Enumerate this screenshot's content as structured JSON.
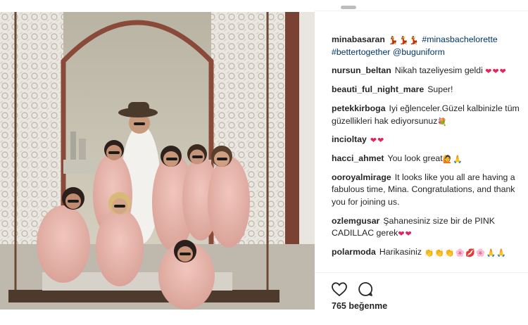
{
  "post": {
    "likes": "765 beğenme",
    "caption": {
      "user": "minabasaran",
      "emojis": "💃💃💃",
      "hashtags": [
        "#minasbachelorette",
        "#bettertogether"
      ],
      "mention": "@buguniform"
    }
  },
  "comments": [
    {
      "user": "nursun_beltan",
      "text": "Nikah tazeliyesim geldi",
      "emoji": "❤❤❤"
    },
    {
      "user": "beauti_ful_night_mare",
      "text": "Super!",
      "emoji": ""
    },
    {
      "user": "petekkirboga",
      "text": "Iyi eğlenceler.Güzel kalbinizle tüm güzellikleri hak ediyorsunuz",
      "emoji": "💐"
    },
    {
      "user": "incioltay",
      "text": "",
      "emoji": "❤❤"
    },
    {
      "user": "hacci_ahmet",
      "text": "You look great",
      "emoji": "🙋🙏"
    },
    {
      "user": "ooroyalmirage",
      "text": "It looks like you all are having a fabulous time, Mina. Congratulations, and thank you for joining us.",
      "emoji": ""
    },
    {
      "user": "ozlemgusar",
      "text": "Şahanesiniz size bir de PINK CADILLAC gerek",
      "emoji": "❤❤"
    },
    {
      "user": "polarmoda",
      "text": "Harikasiniz",
      "emoji": "👏👏👏🌸💋🌸🙏🙏"
    }
  ],
  "icons": [
    "heart-icon",
    "comment-icon"
  ],
  "colors": {
    "hashtag": "#003569",
    "text": "#262626",
    "heart": "#e0245e",
    "divider": "#efefef"
  }
}
